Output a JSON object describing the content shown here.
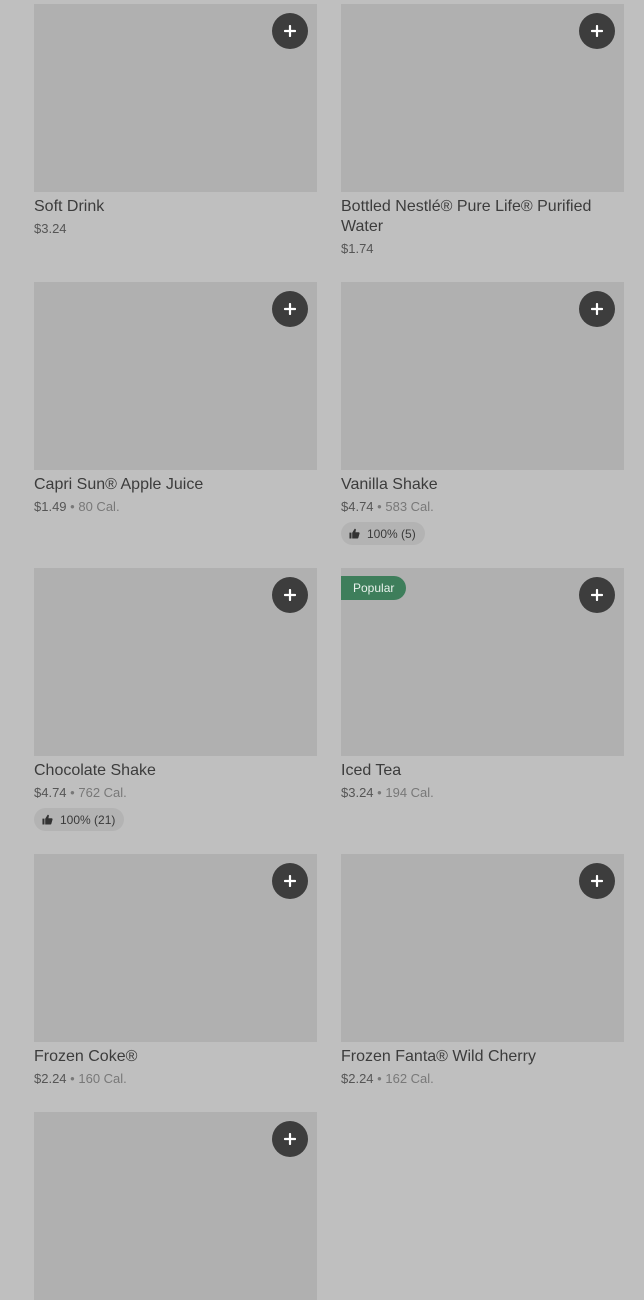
{
  "menu_items": [
    {
      "name": "Soft Drink",
      "price": "$3.24",
      "calories": "",
      "rating": "",
      "badge": ""
    },
    {
      "name": "Bottled Nestlé® Pure Life® Purified Water",
      "price": "$1.74",
      "calories": "",
      "rating": "",
      "badge": ""
    },
    {
      "name": "Capri Sun® Apple Juice",
      "price": "$1.49",
      "calories": "80 Cal.",
      "rating": "",
      "badge": ""
    },
    {
      "name": "Vanilla Shake",
      "price": "$4.74",
      "calories": "583 Cal.",
      "rating": "100% (5)",
      "badge": ""
    },
    {
      "name": "Chocolate Shake",
      "price": "$4.74",
      "calories": "762 Cal.",
      "rating": "100% (21)",
      "badge": ""
    },
    {
      "name": "Iced Tea",
      "price": "$3.24",
      "calories": "194 Cal.",
      "rating": "",
      "badge": "Popular"
    },
    {
      "name": "Frozen Coke®",
      "price": "$2.24",
      "calories": "160 Cal.",
      "rating": "",
      "badge": ""
    },
    {
      "name": "Frozen Fanta® Wild Cherry",
      "price": "$2.24",
      "calories": "162 Cal.",
      "rating": "",
      "badge": ""
    }
  ],
  "separator": "•",
  "icons": {
    "add": "plus-icon",
    "rating": "thumbs-up-icon"
  },
  "colors": {
    "background": "#bfbfbf",
    "thumbnail": "#b0b0b0",
    "add_button": "#3d3d3d",
    "popular_badge": "#3e7e5b"
  }
}
